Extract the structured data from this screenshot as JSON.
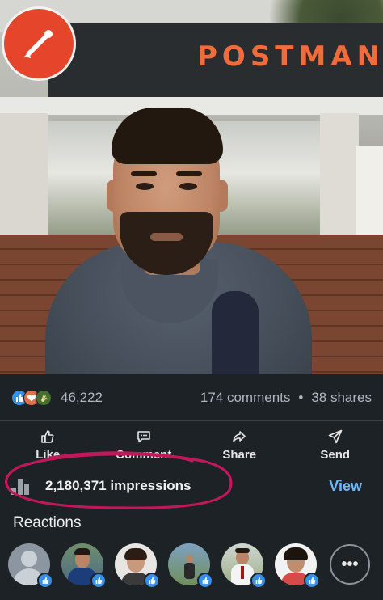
{
  "photo": {
    "sign_text": "POSTMAN",
    "colors": {
      "brand": "#e5452b",
      "sign": "#f26b3a"
    }
  },
  "post": {
    "reaction_icons": [
      "like-icon",
      "love-icon",
      "clap-icon"
    ],
    "reaction_count": "46,222",
    "comments": "174 comments",
    "separator": "•",
    "shares": "38 shares"
  },
  "actions": [
    {
      "label": "Like",
      "icon": "thumbs-up-icon"
    },
    {
      "label": "Comment",
      "icon": "comment-icon"
    },
    {
      "label": "Share",
      "icon": "share-arrow-icon"
    },
    {
      "label": "Send",
      "icon": "send-icon"
    }
  ],
  "impressions": {
    "icon": "bar-chart-icon",
    "text": "2,180,371 impressions",
    "view_label": "View",
    "annotation_color": "#c2185b"
  },
  "reactions": {
    "title": "Reactions",
    "more_label": "•••",
    "avatars": [
      {
        "kind": "placeholder",
        "reaction": "like"
      },
      {
        "kind": "photo",
        "reaction": "like"
      },
      {
        "kind": "photo",
        "reaction": "like"
      },
      {
        "kind": "photo",
        "reaction": "like"
      },
      {
        "kind": "photo",
        "reaction": "like"
      },
      {
        "kind": "photo",
        "reaction": "like"
      }
    ]
  },
  "colors": {
    "background": "#1d2226",
    "accent": "#71b7fb",
    "like_blue": "#378fe9"
  }
}
